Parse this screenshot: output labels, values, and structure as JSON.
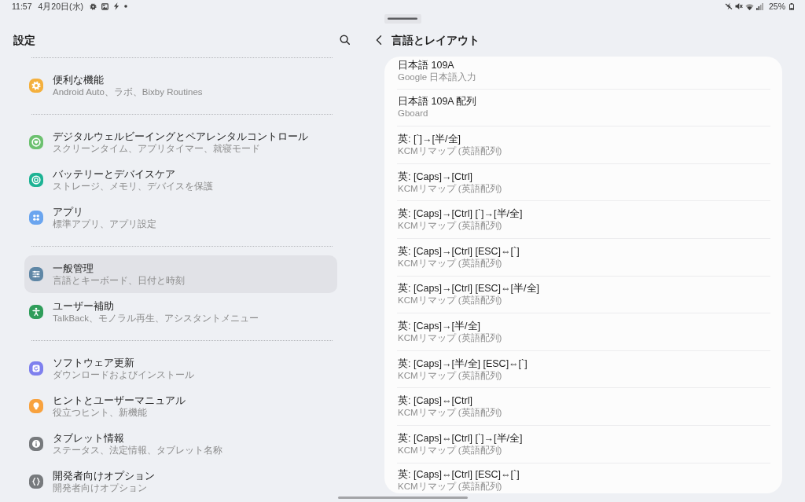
{
  "status_bar": {
    "time": "11:57",
    "date": "4月20日(水)",
    "battery": "25%"
  },
  "settings_panel": {
    "title": "設定",
    "sections": [
      {
        "items": [
          {
            "title": "便利な機能",
            "subtitle": "Android Auto、ラボ、Bixby Routines",
            "selected": false
          }
        ]
      },
      {
        "items": [
          {
            "title": "デジタルウェルビーイングとペアレンタルコントロール",
            "subtitle": "スクリーンタイム、アプリタイマー、就寝モード",
            "selected": false
          },
          {
            "title": "バッテリーとデバイスケア",
            "subtitle": "ストレージ、メモリ、デバイスを保護",
            "selected": false
          },
          {
            "title": "アプリ",
            "subtitle": "標準アプリ、アプリ設定",
            "selected": false
          }
        ]
      },
      {
        "items": [
          {
            "title": "一般管理",
            "subtitle": "言語とキーボード、日付と時刻",
            "selected": true
          },
          {
            "title": "ユーザー補助",
            "subtitle": "TalkBack、モノラル再生、アシスタントメニュー",
            "selected": false
          }
        ]
      },
      {
        "items": [
          {
            "title": "ソフトウェア更新",
            "subtitle": "ダウンロードおよびインストール",
            "selected": false
          },
          {
            "title": "ヒントとユーザーマニュアル",
            "subtitle": "役立つヒント、新機能",
            "selected": false
          },
          {
            "title": "タブレット情報",
            "subtitle": "ステータス、法定情報、タブレット名称",
            "selected": false
          },
          {
            "title": "開発者向けオプション",
            "subtitle": "開発者向けオプション",
            "selected": false
          }
        ]
      }
    ]
  },
  "layout_panel": {
    "title": "言語とレイアウト",
    "items": [
      {
        "title": "日本語 109A",
        "subtitle": "Google 日本語入力"
      },
      {
        "title": "日本語 109A 配列",
        "subtitle": "Gboard"
      },
      {
        "title": "英: [`]→[半/全]",
        "subtitle": "KCMリマップ (英語配列)"
      },
      {
        "title": "英: [Caps]→[Ctrl]",
        "subtitle": "KCMリマップ (英語配列)"
      },
      {
        "title": "英: [Caps]→[Ctrl] [`]→[半/全]",
        "subtitle": "KCMリマップ (英語配列)"
      },
      {
        "title": "英: [Caps]→[Ctrl] [ESC]⇔[`]",
        "subtitle": "KCMリマップ (英語配列)"
      },
      {
        "title": "英: [Caps]→[Ctrl] [ESC]⇔[半/全]",
        "subtitle": "KCMリマップ (英語配列)"
      },
      {
        "title": "英: [Caps]→[半/全]",
        "subtitle": "KCMリマップ (英語配列)"
      },
      {
        "title": "英: [Caps]→[半/全] [ESC]⇔[`]",
        "subtitle": "KCMリマップ (英語配列)"
      },
      {
        "title": "英: [Caps]⇔[Ctrl]",
        "subtitle": "KCMリマップ (英語配列)"
      },
      {
        "title": "英: [Caps]⇔[Ctrl] [`]→[半/全]",
        "subtitle": "KCMリマップ (英語配列)"
      },
      {
        "title": "英: [Caps]⇔[Ctrl] [ESC]⇔[`]",
        "subtitle": "KCMリマップ (英語配列)"
      }
    ]
  }
}
